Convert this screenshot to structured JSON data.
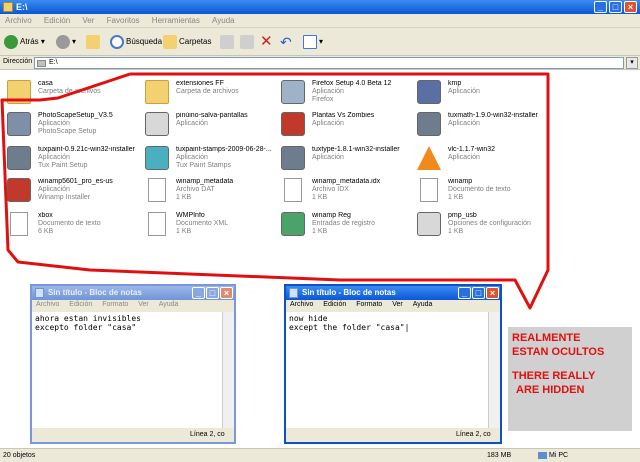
{
  "window": {
    "title": "E:\\"
  },
  "menu": [
    "Archivo",
    "Edición",
    "Ver",
    "Favoritos",
    "Herramientas",
    "Ayuda"
  ],
  "toolbar": {
    "back": "Atrás",
    "search": "Búsqueda",
    "folders": "Carpetas"
  },
  "address": {
    "label": "Dirección",
    "value": "E:\\"
  },
  "items": [
    {
      "name": "casa",
      "type": "Carpeta de archivos",
      "extra": "",
      "icon": "folder-icon",
      "color": "#f3d170"
    },
    {
      "name": "extensiones FF",
      "type": "Carpeta de archivos",
      "extra": "",
      "icon": "folder-icon",
      "color": "#f3d170"
    },
    {
      "name": "Firefox Setup 4.0 Beta 12",
      "type": "Aplicación",
      "extra": "Firefox",
      "icon": "installer-icon",
      "color": "#9fb3c8"
    },
    {
      "name": "kmp",
      "type": "Aplicación",
      "extra": "",
      "icon": "app-icon",
      "color": "#5a6fa3"
    },
    {
      "name": "PhotoScapeSetup_V3.5",
      "type": "Aplicación",
      "extra": "PhotoScape Setup",
      "icon": "app-icon",
      "color": "#7f8fa8"
    },
    {
      "name": "pinúino-salva-pantallas",
      "type": "Aplicación",
      "extra": "",
      "icon": "penguin-icon",
      "color": "#d8d8d8"
    },
    {
      "name": "Plantas Vs Zombies",
      "type": "Aplicación",
      "extra": "",
      "icon": "game-icon",
      "color": "#c0392b"
    },
    {
      "name": "tuxmath-1.9.0-win32-installer",
      "type": "Aplicación",
      "extra": "",
      "icon": "installer-icon",
      "color": "#6d7d8d"
    },
    {
      "name": "tuxpaint-0.9.21c-win32-installer",
      "type": "Aplicación",
      "extra": "Tux Paint Setup",
      "icon": "installer-icon",
      "color": "#6d7d8d"
    },
    {
      "name": "tuxpaint-stamps-2009-06-28-...",
      "type": "Aplicación",
      "extra": "Tux Paint Stamps",
      "icon": "installer-icon",
      "color": "#4ab0c0"
    },
    {
      "name": "tuxtype-1.8.1-win32-installer",
      "type": "Aplicación",
      "extra": "",
      "icon": "installer-icon",
      "color": "#6d7d8d"
    },
    {
      "name": "vlc-1.1.7-win32",
      "type": "Aplicación",
      "extra": "",
      "icon": "vlc-icon",
      "color": "#f08a1c"
    },
    {
      "name": "winamp5601_pro_es-us",
      "type": "Aplicación",
      "extra": "Winamp Installer",
      "icon": "winamp-icon",
      "color": "#c0392b"
    },
    {
      "name": "winamp_metadata",
      "type": "Archivo DAT",
      "extra": "1 KB",
      "icon": "file-icon",
      "color": "#ffffff"
    },
    {
      "name": "winamp_metadata.idx",
      "type": "Archivo IDX",
      "extra": "1 KB",
      "icon": "file-icon",
      "color": "#ffffff"
    },
    {
      "name": "winamp",
      "type": "Documento de texto",
      "extra": "1 KB",
      "icon": "text-file-icon",
      "color": "#ffffff"
    },
    {
      "name": "xbox",
      "type": "Documento de texto",
      "extra": "6 KB",
      "icon": "text-file-icon",
      "color": "#ffffff"
    },
    {
      "name": "WMPInfo",
      "type": "Documento XML",
      "extra": "1 KB",
      "icon": "xml-file-icon",
      "color": "#ffffff"
    },
    {
      "name": "winamp Reg",
      "type": "Entradas de registro",
      "extra": "1 KB",
      "icon": "registry-icon",
      "color": "#4aa36b"
    },
    {
      "name": "pmp_usb",
      "type": "Opciones de configuración",
      "extra": "1 KB",
      "icon": "config-icon",
      "color": "#d8d8d8"
    }
  ],
  "status": {
    "count": "20 objetos",
    "size": "183 MB",
    "location": "Mi PC"
  },
  "notepad1": {
    "title": "Sin título - Bloc de notas",
    "menu": [
      "Archivo",
      "Edición",
      "Formato",
      "Ver",
      "Ayuda"
    ],
    "text": "ahora estan invisibles\nexcepto folder \"casa\"",
    "status": "Línea 2, co"
  },
  "notepad2": {
    "title": "Sin título - Bloc de notas",
    "menu": [
      "Archivo",
      "Edición",
      "Formato",
      "Ver",
      "Ayuda"
    ],
    "text": "now hide\nexcept the folder \"casa\"|",
    "status": "Línea 2, co"
  },
  "callout": {
    "line1": "REALMENTE",
    "line2": "ESTAN OCULTOS",
    "line3": "THERE REALLY",
    "line4": "ARE HIDDEN",
    "color": "#e01010"
  }
}
